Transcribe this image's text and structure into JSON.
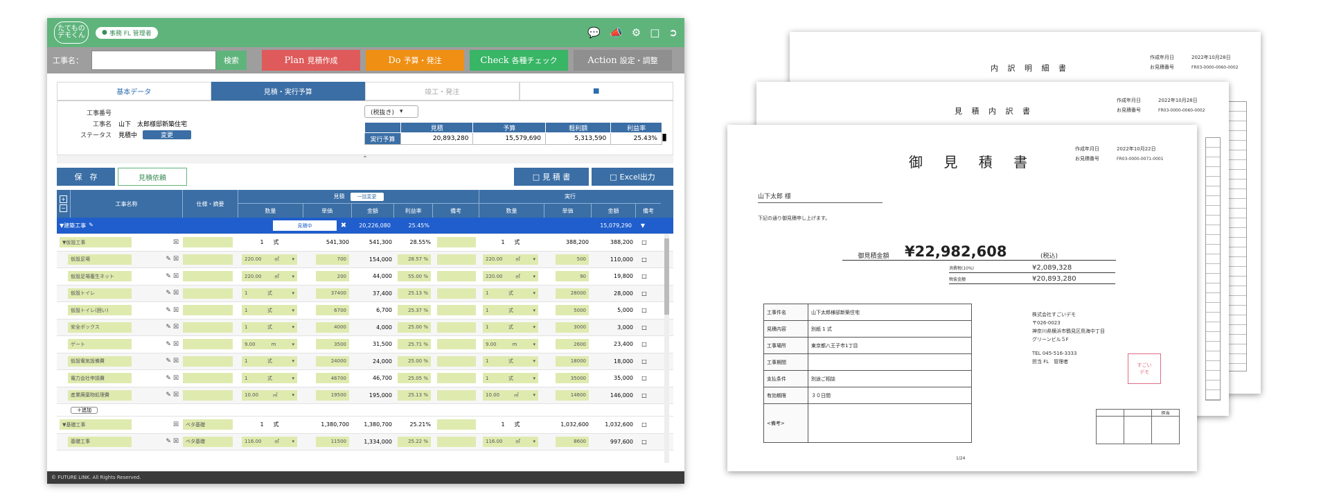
{
  "app": {
    "logo_text": "たてもの\nデモくん",
    "user_badge": "事務 FL 管理者",
    "footer": "© FUTURE LINK. All Rights Reserved."
  },
  "command_bar": {
    "label": "工事名：",
    "search_label": "検索",
    "buttons": [
      {
        "big": "Plan",
        "small": "見積作成",
        "color": "#df5a5a"
      },
      {
        "big": "Do",
        "small": "予算・発注",
        "color": "#ef8f14"
      },
      {
        "big": "Check",
        "small": "各種チェック",
        "color": "#38b565"
      },
      {
        "big": "Action",
        "small": "設定・調整",
        "color": "#8f8f8f"
      }
    ]
  },
  "tabs": [
    {
      "label": "基本データ"
    },
    {
      "label": "見積・実行予算"
    },
    {
      "label": "竣工・発注"
    }
  ],
  "project": {
    "number_label": "工事番号",
    "number_value": "",
    "name_label": "工事名",
    "name_value": "山下　太郎様邸新築住宅",
    "status_label": "ステータス",
    "status_value": "見積中",
    "change_label": "変更",
    "tax_select": "(税抜き)"
  },
  "summary": {
    "headers": [
      "見積",
      "予算",
      "粗利額",
      "利益率"
    ],
    "row_label": "実行予算",
    "values": [
      "20,893,280",
      "15,579,690",
      "5,313,590",
      "25.43%"
    ]
  },
  "actions": {
    "save": "保　存",
    "request": "見積依頼",
    "estimate": "見 積 書",
    "excel": "Excel出力"
  },
  "grid": {
    "headers": {
      "name": "工事名称",
      "spec": "仕様・摘要",
      "estimate_group": "見積",
      "toggle": "一括変更",
      "actual_group": "実行",
      "qty": "数量",
      "unit_price": "単価",
      "amount": "金額",
      "rate": "利益率",
      "note": "備考"
    },
    "section": {
      "name": "▼建築工事",
      "status": "見積中",
      "amount": "20,226,080",
      "rate": "25.45%",
      "actual": "15,079,290"
    },
    "add_label": "＋追加",
    "rows": [
      {
        "name": "▼仮設工事",
        "type": "group",
        "spec": "",
        "qty": "1",
        "unit": "式",
        "price": "541,300",
        "amount": "541,300",
        "rate": "28.55%",
        "aqty": "1",
        "aunit": "式",
        "aprice": "388,200",
        "aamount": "388,200"
      },
      {
        "name": "仮設足場",
        "spec": "",
        "qty": "220.00",
        "unit": "㎡",
        "price": "700",
        "amount": "154,000",
        "rate": "28.57 %",
        "aqty": "220.00",
        "aunit": "㎡",
        "aprice": "500",
        "aamount": "110,000"
      },
      {
        "name": "仮設足場養生ネット",
        "spec": "",
        "qty": "220.00",
        "unit": "㎡",
        "price": "200",
        "amount": "44,000",
        "rate": "55.00 %",
        "aqty": "220.00",
        "aunit": "㎡",
        "aprice": "90",
        "aamount": "19,800"
      },
      {
        "name": "仮設トイレ",
        "spec": "",
        "qty": "1",
        "unit": "式",
        "price": "37400",
        "amount": "37,400",
        "rate": "25.13 %",
        "aqty": "1",
        "aunit": "式",
        "aprice": "28000",
        "aamount": "28,000"
      },
      {
        "name": "仮設トイレ(囲い)",
        "spec": "",
        "qty": "1",
        "unit": "式",
        "price": "6700",
        "amount": "6,700",
        "rate": "25.37 %",
        "aqty": "1",
        "aunit": "式",
        "aprice": "5000",
        "aamount": "5,000"
      },
      {
        "name": "安全ボックス",
        "spec": "",
        "qty": "1",
        "unit": "式",
        "price": "4000",
        "amount": "4,000",
        "rate": "25.00 %",
        "aqty": "1",
        "aunit": "式",
        "aprice": "3000",
        "aamount": "3,000"
      },
      {
        "name": "ゲート",
        "spec": "",
        "qty": "9.00",
        "unit": "m",
        "price": "3500",
        "amount": "31,500",
        "rate": "25.71 %",
        "aqty": "9.00",
        "aunit": "m",
        "aprice": "2600",
        "aamount": "23,400"
      },
      {
        "name": "仮設電気設備費",
        "spec": "",
        "qty": "1",
        "unit": "式",
        "price": "24000",
        "amount": "24,000",
        "rate": "25.00 %",
        "aqty": "1",
        "aunit": "式",
        "aprice": "18000",
        "aamount": "18,000"
      },
      {
        "name": "電力会社申請費",
        "spec": "",
        "qty": "1",
        "unit": "式",
        "price": "46700",
        "amount": "46,700",
        "rate": "25.05 %",
        "aqty": "1",
        "aunit": "式",
        "aprice": "35000",
        "aamount": "35,000"
      },
      {
        "name": "産業廃棄物処理費",
        "spec": "",
        "qty": "10.00",
        "unit": "㎥",
        "price": "19500",
        "amount": "195,000",
        "rate": "25.13 %",
        "aqty": "10.00",
        "aunit": "㎥",
        "aprice": "14600",
        "aamount": "146,000"
      },
      {
        "name": "▼基礎工事",
        "type": "group",
        "spec": "ベタ基礎",
        "qty": "1",
        "unit": "式",
        "price": "1,380,700",
        "amount": "1,380,700",
        "rate": "25.21%",
        "aqty": "1",
        "aunit": "式",
        "aprice": "1,032,600",
        "aamount": "1,032,600"
      },
      {
        "name": "基礎工事",
        "spec": "ベタ基礎",
        "qty": "116.00",
        "unit": "㎡",
        "price": "11500",
        "amount": "1,334,000",
        "rate": "25.22 %",
        "aqty": "116.00",
        "aunit": "㎡",
        "aprice": "8600",
        "aamount": "997,600"
      }
    ]
  },
  "documents": {
    "back_title": "内 訳 明 細 書",
    "middle_title": "見 積 内 訳 書",
    "front_title": "御 見 積 書",
    "meta": {
      "created_label": "作成年月日",
      "quote_no_label": "お見積番号",
      "back_date": "2022年10月28日",
      "back_no": "FR03-0000-0060-0002",
      "middle_date": "2022年10月28日",
      "middle_no": "FR03-0000-0060-0002",
      "front_date": "2022年10月22日",
      "front_no": "FR03-0000-0071-0001"
    },
    "customer": "山下太郎 様",
    "greeting": "下記の通り御見積申し上げます。",
    "total_label": "御見積金額",
    "total_value": "¥22,982,608",
    "tax_note": "(税込)",
    "tax_label": "消費税(10%)",
    "tax_value": "¥2,089,328",
    "net_label": "税抜金額",
    "net_value": "¥20,893,280",
    "details": [
      {
        "k": "工事件名",
        "v": "山下太郎様邸新築住宅"
      },
      {
        "k": "見積内容",
        "v": "別紙 1 式"
      },
      {
        "k": "工事場所",
        "v": "東京都八王子市1丁目"
      },
      {
        "k": "工事期間",
        "v": ""
      },
      {
        "k": "支払条件",
        "v": "別途ご相談"
      },
      {
        "k": "有効期限",
        "v": "３０日間"
      },
      {
        "k": "<備考>",
        "v": ""
      }
    ],
    "company": {
      "name": "株式会社すごいデモ",
      "zip": "〒026-0023",
      "address": "神奈川県横浜市鶴見区鳥海中丁目",
      "building": "グリーンビル５F",
      "tel": "TEL 045-516-3333",
      "staff": "担当 FL　管理者"
    },
    "stamp": "すごい\nデモ",
    "seal_label": "担当",
    "page": "1/24"
  }
}
